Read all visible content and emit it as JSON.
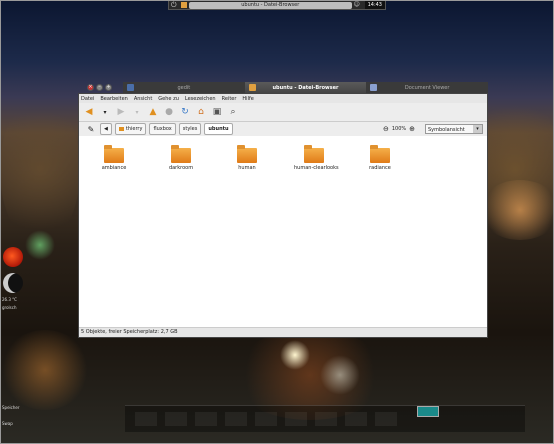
{
  "top_panel": {
    "title": "ubuntu - Datei-Browser",
    "clock": "14:43"
  },
  "taskbar": {
    "tasks": [
      {
        "label": "gedit",
        "color": "#4a6ea8"
      },
      {
        "label": "ubuntu - Datei-Browser",
        "color": "#e0a040"
      },
      {
        "label": "Document Viewer",
        "color": "#8aa0d0"
      }
    ]
  },
  "window": {
    "menu": [
      "Datei",
      "Bearbeiten",
      "Ansicht",
      "Gehe zu",
      "Lesezeichen",
      "Reiter",
      "Hilfe"
    ],
    "breadcrumbs": [
      "thierry",
      "fluxbox",
      "styles",
      "ubuntu"
    ],
    "zoom_level": "100%",
    "view_mode": "Symbolansicht",
    "folders": [
      "ambiance",
      "darkroom",
      "human",
      "human-clearlooks",
      "radiance"
    ],
    "status": "5 Objekte, freier Speicherplatz: 2,7 GB"
  },
  "conky": {
    "lines": [
      "26.3 °C",
      "grolsch",
      "Speicher",
      "Swap"
    ]
  }
}
